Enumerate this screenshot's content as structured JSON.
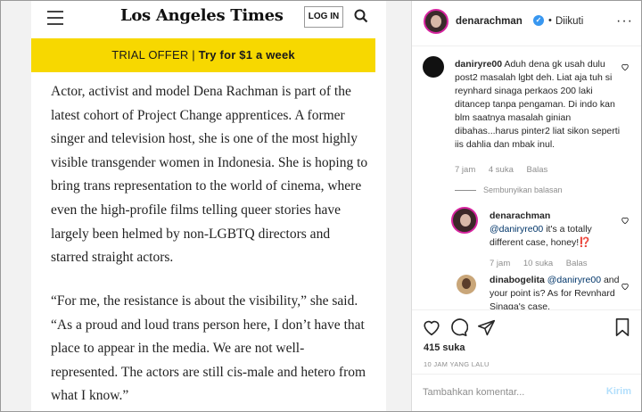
{
  "article": {
    "masthead": "Los Angeles Times",
    "login_label": "LOG IN",
    "trial_prefix": "TRIAL OFFER |",
    "trial_cta": "Try for $1 a week",
    "paragraph1": "Actor, activist and model Dena Rachman is part of the latest cohort of Project Change apprentices. A former singer and television host, she is one of the most highly visible transgender women in Indonesia. She is hoping to bring trans representation to the world of cinema, where even the high-profile films telling queer stories have largely been helmed by non-LGBTQ directors and starred straight actors.",
    "paragraph2": "“For me, the resistance is about the visibility,” she said. “As a proud and loud trans person here, I don’t have that place to appear in the media. We are not well-represented. The actors are still cis-male and hetero from what I know.”",
    "colors": {
      "trial_bg": "#f7d800"
    },
    "icons": [
      "hamburger-menu-icon",
      "search-icon"
    ]
  },
  "instagram": {
    "header": {
      "username": "denarachman",
      "separator": "•",
      "follow_status": "Diikuti",
      "verified_icon": "verified-badge-icon",
      "more_icon": "more-options-icon"
    },
    "comments": [
      {
        "username": "daniryre00",
        "text": "Aduh dena gk usah dulu post2 masalah lgbt deh. Liat aja tuh si reynhard sinaga perkaos 200 laki ditancep tanpa pengaman. Di indo kan blm saatnya masalah ginian dibahas...harus pinter2 liat sikon seperti iis dahlia dan mbak inul.",
        "time": "7 jam",
        "likes": "4 suka",
        "reply": "Balas",
        "hide_replies": "Sembunyikan balasan"
      }
    ],
    "replies": [
      {
        "username": "denarachman",
        "mention": "@daniryre00",
        "text": "it's a totally different case, honey!⁉️",
        "time": "7 jam",
        "likes": "10 suka",
        "reply": "Balas"
      },
      {
        "username": "dinabogelita",
        "mention": "@daniryre00",
        "text": "and your point is? As for Revnhard Sinaga's case."
      }
    ],
    "likes": "415 suka",
    "time_ago": "10 JAM YANG LALU",
    "comment_placeholder": "Tambahkan komentar...",
    "post_label": "Kirim",
    "colors": {
      "accent": "#3897f0",
      "post_disabled": "#b2dffc",
      "story_ring": "#d6249f"
    }
  }
}
